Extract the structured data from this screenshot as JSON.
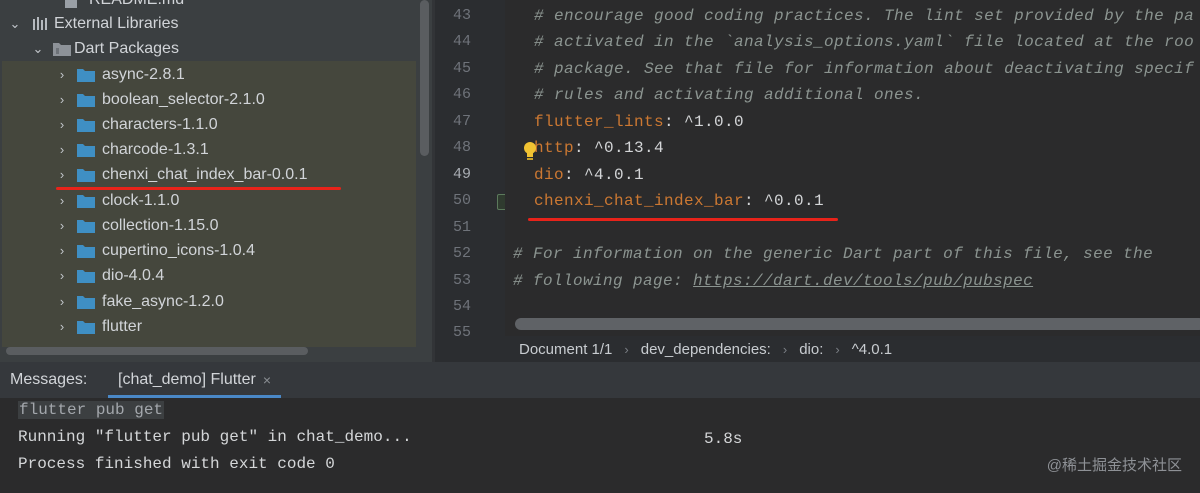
{
  "project_tree": {
    "rows": [
      {
        "label": "README.md",
        "icon": "file-icon",
        "expanded": false
      },
      {
        "label": "External Libraries",
        "icon": "library-icon",
        "expanded": true
      },
      {
        "label": "Dart Packages",
        "icon": "package-folder-icon",
        "expanded": true
      },
      {
        "label": "async-2.8.1",
        "icon": "folder-icon",
        "expanded": false
      },
      {
        "label": "boolean_selector-2.1.0",
        "icon": "folder-icon",
        "expanded": false
      },
      {
        "label": "characters-1.1.0",
        "icon": "folder-icon",
        "expanded": false
      },
      {
        "label": "charcode-1.3.1",
        "icon": "folder-icon",
        "expanded": false
      },
      {
        "label": "chenxi_chat_index_bar-0.0.1",
        "icon": "folder-icon",
        "expanded": false
      },
      {
        "label": "clock-1.1.0",
        "icon": "folder-icon",
        "expanded": false
      },
      {
        "label": "collection-1.15.0",
        "icon": "folder-icon",
        "expanded": false
      },
      {
        "label": "cupertino_icons-1.0.4",
        "icon": "folder-icon",
        "expanded": false
      },
      {
        "label": "dio-4.0.4",
        "icon": "folder-icon",
        "expanded": false
      },
      {
        "label": "fake_async-1.2.0",
        "icon": "folder-icon",
        "expanded": false
      },
      {
        "label": "flutter",
        "icon": "folder-icon",
        "expanded": false
      }
    ]
  },
  "editor": {
    "line_numbers": [
      "43",
      "44",
      "45",
      "46",
      "47",
      "48",
      "49",
      "50",
      "51",
      "52",
      "53",
      "54",
      "55"
    ],
    "current_line": "49",
    "lines": {
      "l43": "# encourage good coding practices. The lint set provided by the pa",
      "l44": "# activated in the `analysis_options.yaml` file located at the roo",
      "l45": "# package. See that file for information about deactivating specif",
      "l46": "# rules and activating additional ones.",
      "l47_key": "flutter_lints",
      "l47_val": ": ^1.0.0",
      "l48_key": "http",
      "l48_val": ": ^0.13.4",
      "l49_key": "dio",
      "l49_val": ": ^4.0.1",
      "l50_key": "chenxi_chat_index_bar",
      "l50_val": ": ^0.0.1",
      "l52": "# For information on the generic Dart part of this file, see the",
      "l53_prefix": "# following page: ",
      "l53_link": "https://dart.dev/tools/pub/pubspec"
    }
  },
  "breadcrumb": {
    "items": [
      "Document 1/1",
      "dev_dependencies:",
      "dio:",
      "^4.0.1"
    ]
  },
  "messages": {
    "title": "Messages:",
    "tab_label": "[chat_demo] Flutter",
    "tab_close": "×",
    "console": {
      "command": "flutter pub get",
      "running": "Running \"flutter pub get\" in chat_demo...",
      "time": "5.8s",
      "finished": "Process finished with exit code 0"
    }
  },
  "watermark": "@稀土掘金技术社区",
  "colors": {
    "annotation_red": "#e8231a",
    "yaml_key": "#cc7832",
    "comment": "#8b9490",
    "tab_accent": "#4a88c7"
  }
}
